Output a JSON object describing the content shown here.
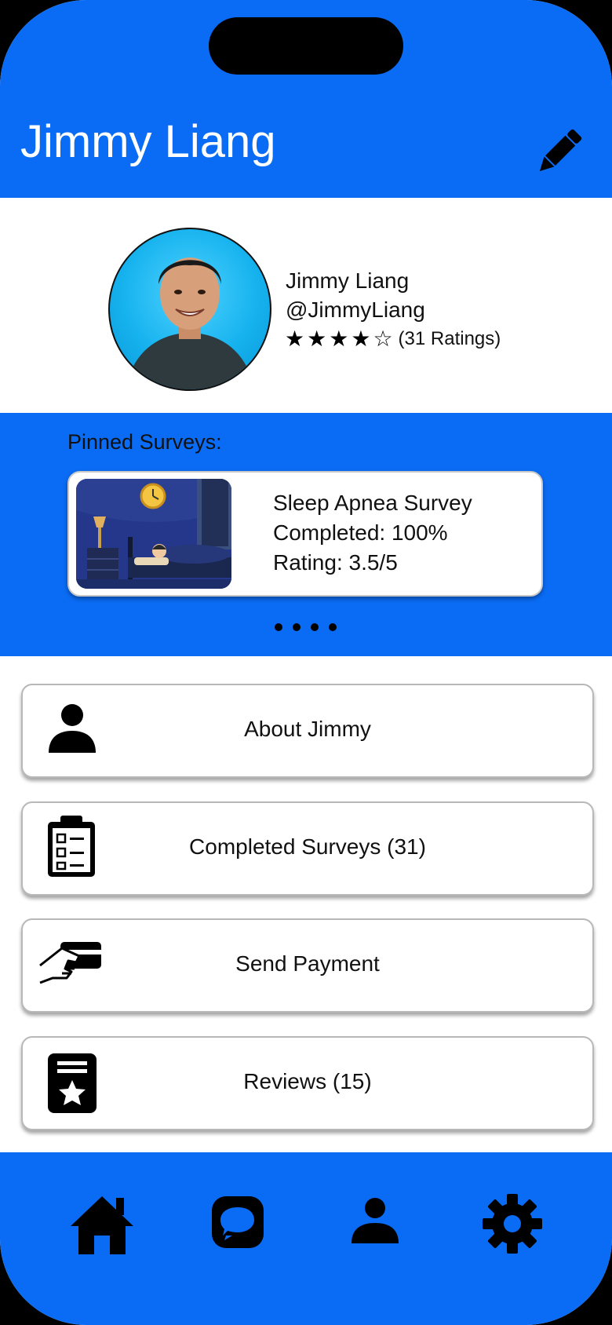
{
  "header": {
    "title": "Jimmy Liang",
    "edit_icon": "pencil-icon"
  },
  "profile": {
    "name": "Jimmy Liang",
    "handle": "@JimmyLiang",
    "stars_filled": 4,
    "stars_total": 5,
    "rating_text": "(31 Ratings)"
  },
  "pinned": {
    "label": "Pinned Surveys:",
    "card": {
      "title": "Sleep Apnea Survey",
      "completed": "Completed: 100%",
      "rating": "Rating: 3.5/5"
    },
    "page_dots": 4
  },
  "menu": [
    {
      "label": "About Jimmy",
      "icon": "person-icon"
    },
    {
      "label": "Completed Surveys (31)",
      "icon": "clipboard-icon"
    },
    {
      "label": "Send Payment",
      "icon": "card-payment-icon"
    },
    {
      "label": "Reviews (15)",
      "icon": "review-badge-icon"
    }
  ],
  "nav": [
    {
      "icon": "home-icon"
    },
    {
      "icon": "chat-bubble-icon"
    },
    {
      "icon": "profile-icon"
    },
    {
      "icon": "gear-icon"
    }
  ],
  "colors": {
    "primary": "#0a6cf5",
    "text": "#111111",
    "card_border": "#b8b8b8"
  }
}
